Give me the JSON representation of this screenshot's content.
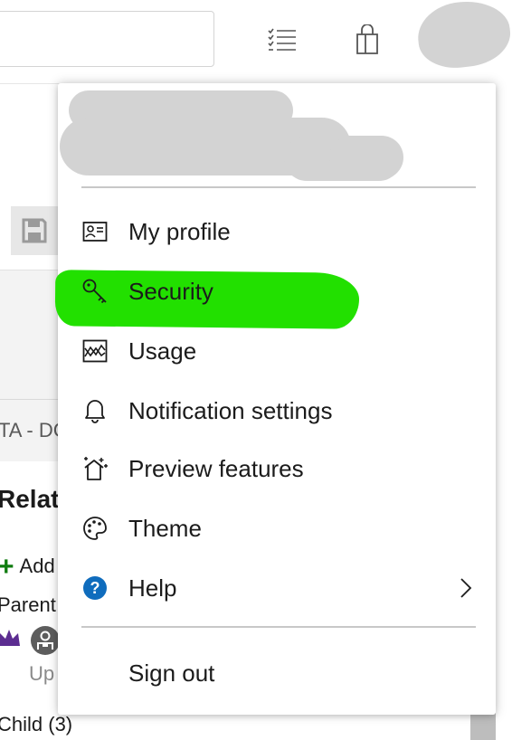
{
  "menu": {
    "items": [
      {
        "label": "My profile",
        "icon": "profile-card-icon"
      },
      {
        "label": "Security",
        "icon": "key-icon"
      },
      {
        "label": "Usage",
        "icon": "usage-chart-icon"
      },
      {
        "label": "Notification settings",
        "icon": "bell-icon"
      },
      {
        "label": "Preview features",
        "icon": "sparkle-house-icon"
      },
      {
        "label": "Theme",
        "icon": "palette-icon"
      },
      {
        "label": "Help",
        "icon": "help-icon"
      }
    ],
    "sign_out": "Sign out",
    "highlight_color": "#22e000"
  },
  "background": {
    "ta_label": "TA - DC",
    "related_title": "Relat",
    "add_label": "Add",
    "parent_label": "Parent",
    "up_label": "Up",
    "child_label": "Child (3)"
  },
  "colors": {
    "help_blue": "#0f6cbd",
    "add_green": "#107c10",
    "crown_purple": "#5c2d91",
    "redaction_gray": "#d3d3d3"
  }
}
